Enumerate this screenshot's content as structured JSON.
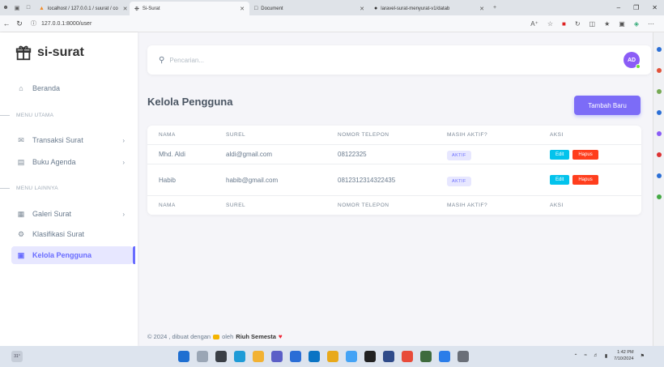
{
  "browser": {
    "tabs": [
      {
        "title": "localhost / 127.0.0.1 / suurat / co",
        "active": false
      },
      {
        "title": "Si-Surat",
        "active": true
      },
      {
        "title": "Document",
        "active": false
      },
      {
        "title": "laravel-surat-menyurat-v1/datab",
        "active": false
      }
    ],
    "url": "127.0.0.1:8000/user"
  },
  "sidebar": {
    "brand": "si-surat",
    "beranda": "Beranda",
    "header_utama": "MENU UTAMA",
    "transaksi": "Transaksi Surat",
    "agenda": "Buku Agenda",
    "header_lainnya": "MENU LAINNYA",
    "galeri": "Galeri Surat",
    "klasifikasi": "Klasifikasi Surat",
    "pengguna": "Kelola Pengguna"
  },
  "topnav": {
    "search_placeholder": "Pencarian...",
    "avatar_initials": "AD"
  },
  "main": {
    "title": "Kelola Pengguna",
    "add_button": "Tambah Baru",
    "table": {
      "headers": [
        "NAMA",
        "SUREL",
        "NOMOR TELEPON",
        "MASIH AKTIF?",
        "AKSI"
      ],
      "rows": [
        {
          "nama": "Mhd. Aldi",
          "surel": "aldi@gmail.com",
          "telepon": "08122325",
          "status": "AKTIF",
          "edit": "Edit",
          "hapus": "Hapus"
        },
        {
          "nama": "Habib",
          "surel": "habib@gmail.com",
          "telepon": "0812312314322435",
          "status": "AKTIF",
          "edit": "Edit",
          "hapus": "Hapus"
        }
      ]
    }
  },
  "footer": {
    "prefix": "© 2024 , dibuat dengan",
    "middle": "oleh",
    "author": "Riuh Semesta"
  },
  "taskbar": {
    "time": "1:42 PM",
    "date": "7/10/2024"
  },
  "colors": {
    "primary": "#696cff",
    "edit": "#03c3ec",
    "delete": "#ff3e1d"
  }
}
